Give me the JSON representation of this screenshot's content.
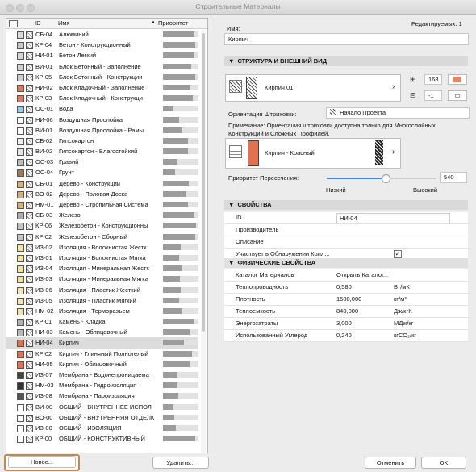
{
  "window": {
    "title": "Строительные Материалы"
  },
  "list": {
    "headers": {
      "id": "ID",
      "name": "Имя",
      "priority": "Приоритет",
      "sort_icon": "triangle-up-icon"
    },
    "rows": [
      {
        "id": "СБ-04",
        "name": "Алюминий",
        "c": "#d9d9d9",
        "p": 0.88
      },
      {
        "id": "КР-04",
        "name": "Бетон - Конструкционный",
        "c": "#c9c9c9",
        "p": 0.92
      },
      {
        "id": "НИ-01",
        "name": "Бетон Легкий",
        "c": "#d5d5d5",
        "p": 0.86
      },
      {
        "id": "ВИ-01",
        "name": "Блок Бетонный - Заполнение",
        "c": "#cfcfcf",
        "p": 0.8
      },
      {
        "id": "КР-05",
        "name": "Блок Бетонный - Конструкции",
        "c": "#cfcfcf",
        "p": 0.9
      },
      {
        "id": "НИ-02",
        "name": "Блок Кладочный - Заполнение",
        "c": "#e07a5f",
        "p": 0.78
      },
      {
        "id": "КР-03",
        "name": "Блок Кладочный - Конструкци",
        "c": "#e07a5f",
        "p": 0.84
      },
      {
        "id": "ОС-01",
        "name": "Вода",
        "c": "#9fc5e8",
        "p": 0.3
      },
      {
        "id": "НИ-06",
        "name": "Воздушная Прослойка",
        "c": "#ffffff",
        "p": 0.45
      },
      {
        "id": "ВИ-01",
        "name": "Воздушная Прослойка - Рамы",
        "c": "#ffffff",
        "p": 0.55
      },
      {
        "id": "СБ-02",
        "name": "Гипсокартон",
        "c": "#eeeeee",
        "p": 0.7
      },
      {
        "id": "ВИ-02",
        "name": "Гипсокартон - Влагостойкий",
        "c": "#e6e6e6",
        "p": 0.7
      },
      {
        "id": "ОС-03",
        "name": "Гравий",
        "c": "#bdbdbd",
        "p": 0.4
      },
      {
        "id": "ОС-04",
        "name": "Грунт",
        "c": "#9b7b58",
        "p": 0.35
      },
      {
        "id": "СБ-01",
        "name": "Дерево - Конструкции",
        "c": "#d8b07a",
        "p": 0.72
      },
      {
        "id": "ВО-02",
        "name": "Дерево - Половая Доска",
        "c": "#d8b07a",
        "p": 0.66
      },
      {
        "id": "НМ-01",
        "name": "Дерево - Стропильная Система",
        "c": "#d8b07a",
        "p": 0.7
      },
      {
        "id": "СБ-03",
        "name": "Железо",
        "c": "#aaaaaa",
        "p": 0.88
      },
      {
        "id": "КР-06",
        "name": "Железобетон - Конструкционны",
        "c": "#c4c4c4",
        "p": 0.94
      },
      {
        "id": "КР-02",
        "name": "Железобетон - Сборный",
        "c": "#c4c4c4",
        "p": 0.92
      },
      {
        "id": "ИЗ-02",
        "name": "Изоляция - Волокнистая Жестк",
        "c": "#f2e6a0",
        "p": 0.5
      },
      {
        "id": "ИЗ-01",
        "name": "Изоляция - Волокнистая Мягка",
        "c": "#f2e6a0",
        "p": 0.46
      },
      {
        "id": "ИЗ-04",
        "name": "Изоляция - Минеральная Жестк",
        "c": "#efe2a0",
        "p": 0.52
      },
      {
        "id": "ИЗ-03",
        "name": "Изоляция - Минеральная Мягка",
        "c": "#efe2a0",
        "p": 0.48
      },
      {
        "id": "ИЗ-06",
        "name": "Изоляция - Пластик Жесткий",
        "c": "#f4e7b5",
        "p": 0.5
      },
      {
        "id": "ИЗ-05",
        "name": "Изоляция - Пластик Мягкий",
        "c": "#f4e7b5",
        "p": 0.46
      },
      {
        "id": "НМ-02",
        "name": "Изоляция - Терморазъем",
        "c": "#f0e4a8",
        "p": 0.55
      },
      {
        "id": "КР-01",
        "name": "Камень - Кладка",
        "c": "#b0b0b0",
        "p": 0.86
      },
      {
        "id": "НИ-03",
        "name": "Камень - Облицовочный",
        "c": "#b8b8b8",
        "p": 0.74
      },
      {
        "id": "НИ-04",
        "name": "Кирпич",
        "c": "#e4714e",
        "p": 0.6,
        "selected": true
      },
      {
        "id": "КР-02",
        "name": "Кирпич - Глиняный Полнотелый",
        "c": "#e4714e",
        "p": 0.82
      },
      {
        "id": "НИ-05",
        "name": "Кирпич - Облицовочный",
        "c": "#e4714e",
        "p": 0.74
      },
      {
        "id": "ИЗ-07",
        "name": "Мембрана - Водонепроницаема",
        "c": "#444444",
        "p": 0.4
      },
      {
        "id": "НМ-03",
        "name": "Мембрана - Гидроизоляция",
        "c": "#333333",
        "p": 0.42
      },
      {
        "id": "ИЗ-08",
        "name": "Мембрана - Пароизоляция",
        "c": "#555555",
        "p": 0.44
      },
      {
        "id": "ВИ-00",
        "name": "ОБЩИЙ - ВНУТРЕННЕЕ ИСПОЛ",
        "c": "#ffffff",
        "p": 0.3
      },
      {
        "id": "ВО-00",
        "name": "ОБЩИЙ - ВНУТРЕННЯЯ ОТДЕЛК",
        "c": "#ffffff",
        "p": 0.32
      },
      {
        "id": "ИЗ-00",
        "name": "ОБЩИЙ - ИЗОЛЯЦИЯ",
        "c": "#ffffff",
        "p": 0.36
      },
      {
        "id": "КР-00",
        "name": "ОБЩИЙ - КОНСТРУКТИВНЫЙ",
        "c": "#ffffff",
        "p": 0.9
      }
    ]
  },
  "buttons": {
    "new": "Новое...",
    "delete": "Удалить...",
    "cancel": "Отменить",
    "ok": "OK"
  },
  "details": {
    "editable_label": "Редактируемых: 1",
    "name_label": "Имя:",
    "name_value": "Кирпич",
    "section_structure": "СТРУКТУРА И ВНЕШНИЙ ВИД",
    "cut_fill": "Кирпич 01",
    "pen_value": "168",
    "pen_value2": "-1",
    "hatch_orientation_label": "Ориентация Штриховки:",
    "hatch_orientation_value": "Начало Проекта",
    "note": "Примечание: Ориентация штриховки доступна только для Многослойных Конструкций и Сложных Профилей.",
    "surface": "Кирпич - Красный",
    "intersection_label": "Приоритет Пересечения:",
    "intersection_value": "540",
    "slider_low": "Низкий",
    "slider_high": "Высокий",
    "slider_level": 0.54,
    "section_props": "СВОЙСТВА",
    "props": [
      {
        "a": "ID",
        "b": "НИ-04"
      },
      {
        "a": "Производитель",
        "b": ""
      },
      {
        "a": "Описание",
        "b": ""
      },
      {
        "a": "Участвует в Обнаружении Колл...",
        "b": "✓"
      }
    ],
    "section_physical": "ФИЗИЧЕСКИЕ СВОЙСТВА",
    "physical": [
      {
        "a": "Каталог Материалов",
        "b": "Открыть Каталог...",
        "c": ""
      },
      {
        "a": "Теплопроводность",
        "b": "0,580",
        "c": "Вт/мК"
      },
      {
        "a": "Плотность",
        "b": "1500,000",
        "c": "кг/м³"
      },
      {
        "a": "Теплоемкость",
        "b": "840,000",
        "c": "Дж/кгК"
      },
      {
        "a": "Энергозатраты",
        "b": "3,000",
        "c": "МДж/кг"
      },
      {
        "a": "Использованный Углерод",
        "b": "0,240",
        "c": "кгСО₂/кг"
      }
    ]
  }
}
